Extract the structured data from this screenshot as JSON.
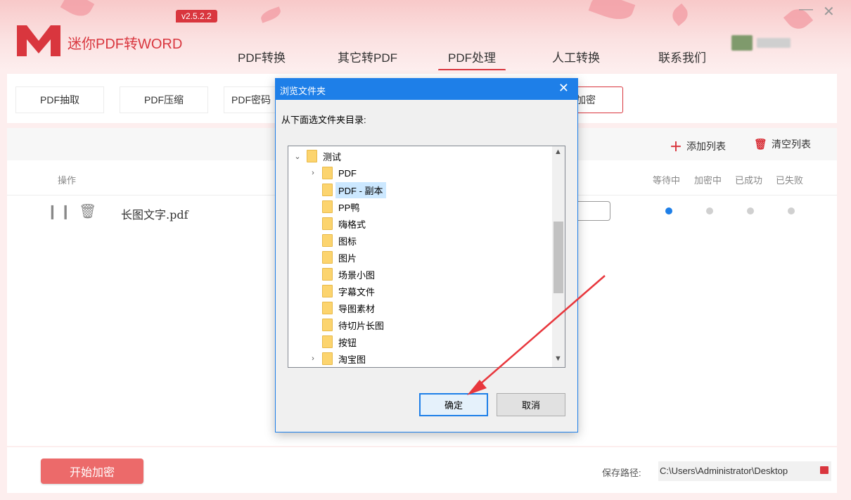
{
  "app": {
    "name": "迷你PDF转WORD",
    "version": "v2.5.2.2",
    "window_controls": {
      "minimize": "—",
      "close": "✕"
    }
  },
  "nav": {
    "items": [
      "PDF转换",
      "其它转PDF",
      "PDF处理",
      "人工转换",
      "联系我们"
    ],
    "active": "PDF处理"
  },
  "subtabs": {
    "items": [
      "PDF抽取",
      "PDF压缩",
      "PDF密码",
      "加密"
    ],
    "active": "加密"
  },
  "list": {
    "add_label": "添加列表",
    "clear_label": "清空列表",
    "headers": {
      "operation": "操作",
      "waiting": "等待中",
      "encrypting": "加密中",
      "success": "已成功",
      "failed": "已失败"
    },
    "files": [
      {
        "name": "长图文字.pdf",
        "status": "等待中"
      }
    ]
  },
  "bottom": {
    "start_label": "开始加密",
    "save_path_label": "保存路径:",
    "save_path_value": "C:\\Users\\Administrator\\Desktop"
  },
  "dialog": {
    "title": "浏览文件夹",
    "prompt": "从下面选文件夹目录:",
    "tree": [
      {
        "label": "测试",
        "level": 0,
        "expanded": true
      },
      {
        "label": "PDF",
        "level": 1,
        "expandable": true
      },
      {
        "label": "PDF - 副本",
        "level": 1,
        "selected": true
      },
      {
        "label": "PP鸭",
        "level": 1
      },
      {
        "label": "嗨格式",
        "level": 1
      },
      {
        "label": "图标",
        "level": 1
      },
      {
        "label": "图片",
        "level": 1
      },
      {
        "label": "场景小图",
        "level": 1
      },
      {
        "label": "字幕文件",
        "level": 1
      },
      {
        "label": "导图素材",
        "level": 1
      },
      {
        "label": "待切片长图",
        "level": 1
      },
      {
        "label": "按钮",
        "level": 1
      },
      {
        "label": "淘宝图",
        "level": 1,
        "expandable": true
      }
    ],
    "ok_label": "确定",
    "cancel_label": "取消"
  },
  "colors": {
    "brand": "#d9363e",
    "accent_blue": "#1e7fe8",
    "start_button": "#ec6a6a",
    "annotation_arrow": "#e8373d"
  }
}
